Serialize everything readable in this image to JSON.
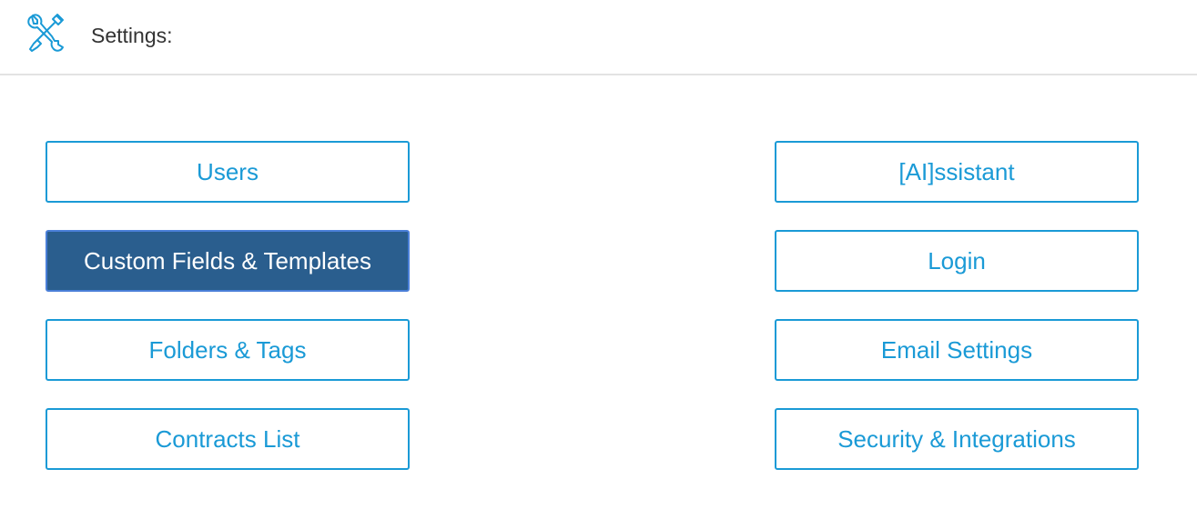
{
  "header": {
    "icon": "tools-icon",
    "title": "Settings:"
  },
  "colors": {
    "accent": "#1a9ad6",
    "active_bg": "#2a5e8e",
    "active_text": "#ffffff"
  },
  "buttons": {
    "users": "Users",
    "custom_fields": "Custom Fields & Templates",
    "folders_tags": "Folders & Tags",
    "contracts_list": "Contracts List",
    "assistant": "[AI]ssistant",
    "login": "Login",
    "email_settings": "Email Settings",
    "security_integrations": "Security & Integrations"
  },
  "active_button": "custom_fields"
}
